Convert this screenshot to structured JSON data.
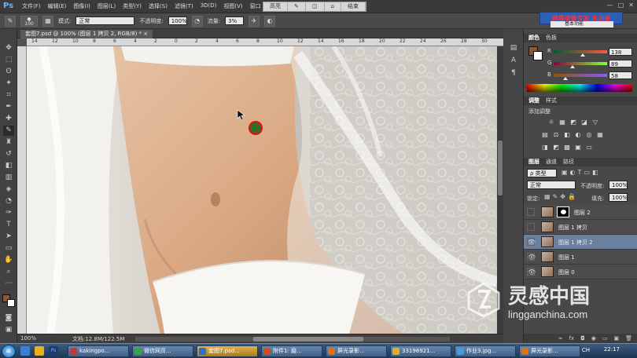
{
  "app": {
    "logo": "Ps",
    "menus": [
      "文件(F)",
      "编辑(E)",
      "图像(I)",
      "图层(L)",
      "类型(Y)",
      "选择(S)",
      "滤镜(T)",
      "3D(D)",
      "视图(V)",
      "窗口"
    ],
    "window_controls": [
      "—",
      "□",
      "✕"
    ]
  },
  "recorder": {
    "buttons": [
      "高亮",
      "",
      "",
      "",
      "结束"
    ],
    "banner": "屏幕录像专家 未注册"
  },
  "options": {
    "brush_size": "100",
    "mode_label": "模式:",
    "mode_value": "正常",
    "opacity_label": "不透明度:",
    "opacity_value": "100%",
    "flow_label": "流量:",
    "flow_value": "3%",
    "workspace": "基本功能"
  },
  "document": {
    "tab_title": "套图7.psd @ 100% (图层 1 拷贝 2, RGB/8) *",
    "tab_close": "×",
    "ruler_marks": [
      "14",
      "12",
      "10",
      "8",
      "6",
      "4",
      "2",
      "0",
      "2",
      "4",
      "6",
      "8",
      "10",
      "12",
      "14",
      "16",
      "18",
      "20",
      "22",
      "24",
      "26",
      "28",
      "30"
    ],
    "zoom": "100%",
    "doc_size": "文档:12.8M/122.5M"
  },
  "color_panel": {
    "tabs": [
      "颜色",
      "色板"
    ],
    "r_label": "R",
    "r_value": "138",
    "r_frac": 0.541,
    "g_label": "G",
    "g_value": "89",
    "g_frac": 0.349,
    "b_label": "B",
    "b_value": "58",
    "b_frac": 0.227,
    "foreground": "#8a593a",
    "background": "#ffffff"
  },
  "adjust_panel": {
    "tabs": [
      "调整",
      "样式"
    ],
    "title": "添加调整",
    "row1": [
      "☼",
      "▦",
      "◩",
      "◪",
      "▽"
    ],
    "row2": [
      "▤",
      "⚖",
      "◧",
      "◐",
      "◎",
      "▦"
    ],
    "row3": [
      "◨",
      "◩",
      "▩",
      "▣",
      "▭"
    ]
  },
  "layers_panel": {
    "tabs": [
      "图层",
      "通道",
      "路径"
    ],
    "filter_label": "ρ 类型",
    "blend_mode": "正常",
    "opacity_label": "不透明度:",
    "opacity_value": "100%",
    "lock_label": "锁定:",
    "fill_label": "填充:",
    "fill_value": "100%",
    "layers": [
      {
        "name": "图层 2",
        "visible": false,
        "mask": true,
        "selected": false
      },
      {
        "name": "图层 1 拷贝",
        "visible": false,
        "mask": false,
        "selected": false
      },
      {
        "name": "图层 1 拷贝 2",
        "visible": true,
        "mask": false,
        "selected": true
      },
      {
        "name": "图层 1",
        "visible": true,
        "mask": false,
        "selected": false
      },
      {
        "name": "图层 0",
        "visible": true,
        "mask": false,
        "selected": false
      }
    ],
    "bottom_icons": [
      "∞",
      "fx",
      "◘",
      "◉",
      "▭",
      "▣",
      "🗑"
    ]
  },
  "watermark": {
    "cn": "灵感中国",
    "en": "lingganchina.com"
  },
  "taskbar": {
    "start": "⊞",
    "items": [
      {
        "label": "kakingpo...",
        "color": "#cc3333",
        "active": false
      },
      {
        "label": "微信网页...",
        "color": "#33aa33",
        "active": false
      },
      {
        "label": "套图7.psd...",
        "color": "#2a6fd6",
        "active": true
      },
      {
        "label": "附件1: 磨...",
        "color": "#d94a1f",
        "active": false
      },
      {
        "label": "屏光录影...",
        "color": "#e07010",
        "active": false
      },
      {
        "label": "33196921...",
        "color": "#e0b020",
        "active": false
      },
      {
        "label": "作业3.jpg...",
        "color": "#3aa0e0",
        "active": false
      },
      {
        "label": "屏光录影...",
        "color": "#e07010",
        "active": false
      }
    ],
    "tray": "CH",
    "clock": "22:17"
  },
  "brand_colors": {
    "accent": "#2b5fb8",
    "selection": "#6b7f9e",
    "brush_marker_ring": "#e01010",
    "brush_marker_fill": "#3a6a2a"
  }
}
